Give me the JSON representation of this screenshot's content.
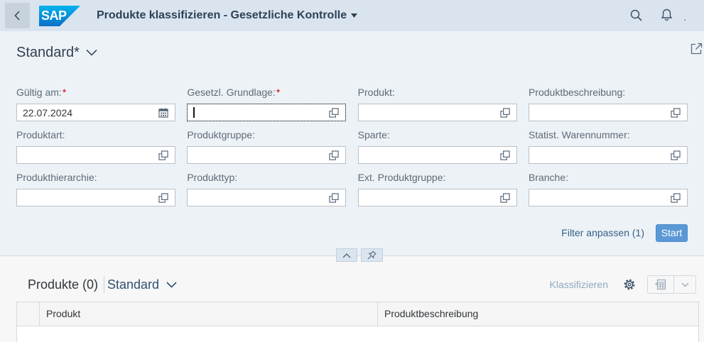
{
  "shell": {
    "logo_text": "SAP",
    "title": "Produkte klassifizieren - Gesetzliche Kontrolle",
    "icons": {
      "back": "back-icon",
      "title_menu": "triangle-down-icon",
      "search": "search-icon",
      "notifications": "bell-icon"
    }
  },
  "header": {
    "variant": "Standard*",
    "icons": {
      "variant_menu": "chevron-down-icon",
      "share": "share-icon"
    }
  },
  "required_marker": "*",
  "filters": [
    {
      "label": "Gültig am:",
      "required": true,
      "value": "22.07.2024",
      "icon": "calendar-icon"
    },
    {
      "label": "Gesetzl. Grundlage:",
      "required": true,
      "value": "",
      "icon": "value-help-icon",
      "focused": true
    },
    {
      "label": "Produkt:",
      "value": "",
      "icon": "value-help-icon"
    },
    {
      "label": "Produktbeschreibung:",
      "value": "",
      "icon": "value-help-icon"
    },
    {
      "label": "Produktart:",
      "value": "",
      "icon": "value-help-icon"
    },
    {
      "label": "Produktgruppe:",
      "value": "",
      "icon": "value-help-icon"
    },
    {
      "label": "Sparte:",
      "value": "",
      "icon": "value-help-icon"
    },
    {
      "label": "Statist. Warennummer:",
      "value": "",
      "icon": "value-help-icon"
    },
    {
      "label": "Produkthierarchie:",
      "value": "",
      "icon": "value-help-icon"
    },
    {
      "label": "Produkttyp:",
      "value": "",
      "icon": "value-help-icon"
    },
    {
      "label": "Ext. Produktgruppe:",
      "value": "",
      "icon": "value-help-icon"
    },
    {
      "label": "Branche:",
      "value": "",
      "icon": "value-help-icon"
    }
  ],
  "filter_bar": {
    "adapt_filters_label": "Filter anpassen (1)",
    "go_label": "Start",
    "icons": {
      "collapse": "chevron-up-icon",
      "pin": "pin-icon"
    }
  },
  "table": {
    "title": "Produkte (0)",
    "variant": "Standard",
    "classify_label": "Klassifizieren",
    "icons": {
      "variant_menu": "chevron-down-icon",
      "settings": "gear-icon",
      "export": "spreadsheet-icon",
      "export_menu": "chevron-down-icon"
    },
    "columns": [
      "Produkt",
      "Produktbeschreibung"
    ],
    "rows": []
  },
  "colors": {
    "shell_background": "#dae4ee",
    "header_background": "#edf2f7",
    "page_background": "#f7f7f7",
    "emphasized_button": "#5a98d6",
    "link": "#346187",
    "required": "#d40000",
    "disabled_text": "#8ea8c1"
  }
}
